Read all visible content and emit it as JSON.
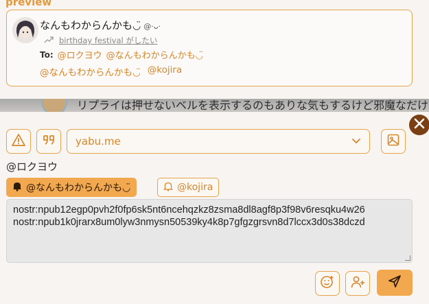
{
  "preview": {
    "label": "preview",
    "author_name": "なんもわからんかも",
    "author_face": "◡̈",
    "author_handle": "@·ᴗ·",
    "repost_text": "birthday festival がしたい",
    "to_label": "To:",
    "to_mentions": [
      "@ロクヨウ",
      "@なんもわからんかも◡̈"
    ],
    "body_mentions": [
      "@なんもわからんかも◡̈",
      "@kojira"
    ]
  },
  "timeline_peek": {
    "text": "リプライは押せないベルを表示するのもありな気もするけど邪魔なだけな"
  },
  "toolbar": {
    "warning_icon": "warning-icon",
    "quote_icon": "quote-icon",
    "relay_value": "yabu.me",
    "image_icon": "image-icon"
  },
  "close_icon": "close-icon",
  "reply_to": "@ロクヨウ",
  "notify_chips": [
    {
      "label": "@なんもわからんかも◡̈",
      "active": true
    },
    {
      "label": "@kojira",
      "active": false
    }
  ],
  "note": {
    "lines": [
      "nostr:npub12egp0pvh2f0fp6sk5nt6ncehqzkz8zsma8dl8agf8p3f98v6resqku4w26",
      "nostr:npub1k0jrarx8um0lyw3nmysn50539ky4k8p7gfgzgrsvn8d7lccx3d0s38dczd"
    ]
  },
  "actions": {
    "emoji_icon": "emoji-icon",
    "add_user_icon": "add-user-icon",
    "send_icon": "send-icon"
  },
  "colors": {
    "accent": "#e3a44d",
    "accent_text": "#d6862a",
    "send_bg": "#f2a84f",
    "close_bg": "#7a3f12"
  }
}
